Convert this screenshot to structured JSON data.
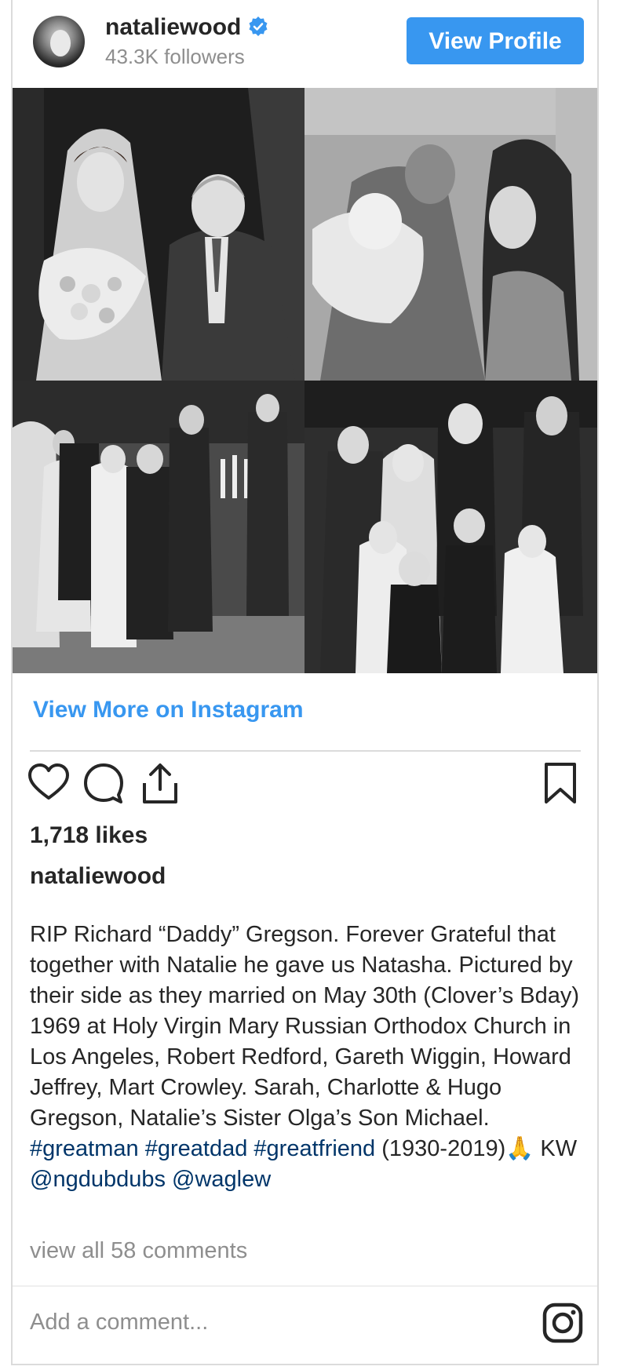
{
  "header": {
    "username": "nataliewood",
    "followers": "43.3K followers",
    "view_profile_label": "View Profile",
    "avatar_icon": "profile-photo",
    "verified_icon": "verified-badge-icon"
  },
  "photos": [
    {
      "name": "photo-bride-and-groom"
    },
    {
      "name": "photo-family-with-baby"
    },
    {
      "name": "photo-wedding-party-church"
    },
    {
      "name": "photo-wedding-group-children"
    }
  ],
  "view_more_label": "View More on Instagram",
  "actions": {
    "like_icon": "heart-icon",
    "comment_icon": "comment-icon",
    "share_icon": "share-icon",
    "save_icon": "bookmark-icon"
  },
  "likes": "1,718 likes",
  "caption": {
    "username": "nataliewood",
    "text_main": "RIP Richard “Daddy” Gregson. Forever Grateful that together with Natalie he gave us Natasha. Pictured by their side as they married on May 30th (Clover’s Bday) 1969 at Holy Virgin Mary Russian Orthodox Church in Los Angeles, Robert Redford, Gareth Wiggin, Howard Jeffrey, Mart Crowley. Sarah, Charlotte & Hugo Gregson, Natalie’s Sister Olga’s Son Michael. ",
    "hashtag_1": "#greatman",
    "hashtag_2": "#greatdad",
    "hashtag_3": "#greatfriend",
    "text_years": " (1930-2019)",
    "emoji": "🙏",
    "text_kw": " KW ",
    "mention_1": "@ngdubdubs",
    "mention_2": "@waglew"
  },
  "comments_link": "view all 58 comments",
  "comment_input": {
    "placeholder": "Add a comment..."
  },
  "footer": {
    "instagram_icon": "instagram-icon"
  },
  "colors": {
    "accent": "#3897f0",
    "hashtag": "#003569",
    "muted": "#8e8e8e",
    "text": "#262626",
    "border": "#dbdbdb"
  }
}
